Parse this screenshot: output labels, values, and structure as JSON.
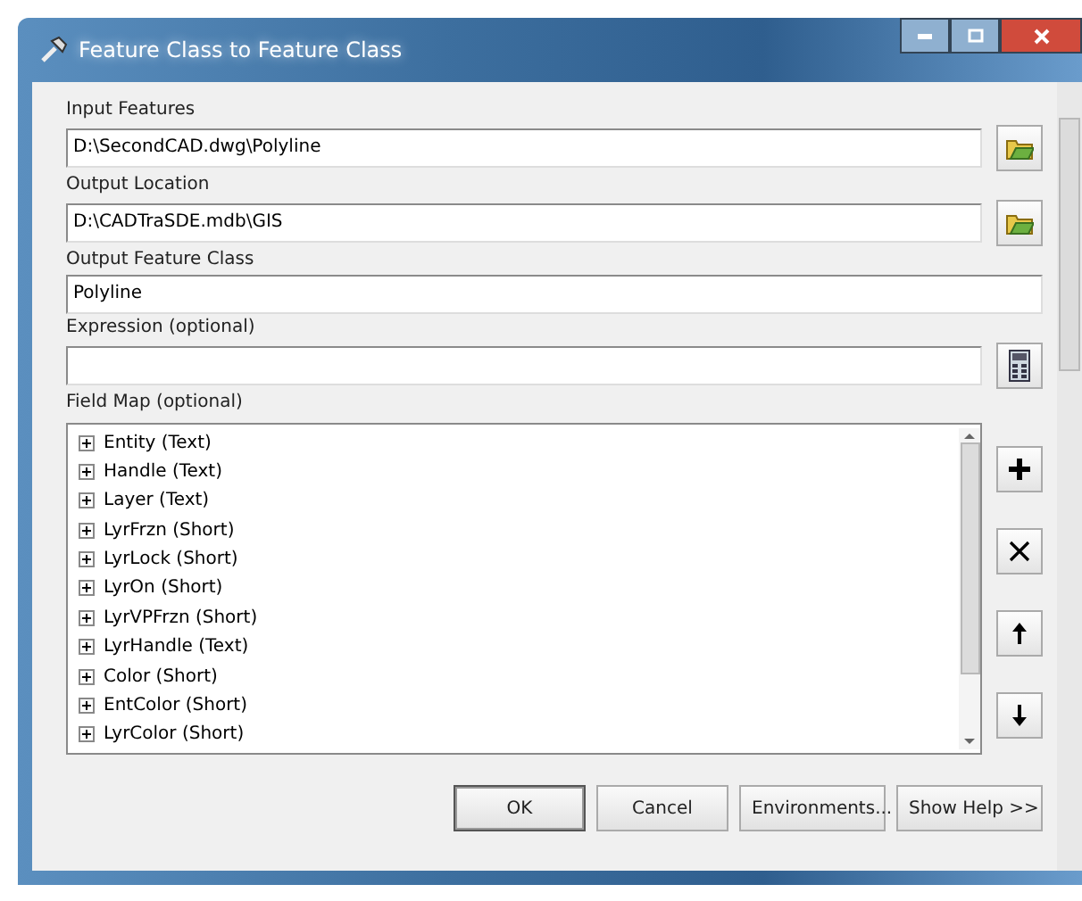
{
  "window": {
    "title": "Feature Class to Feature Class"
  },
  "fields": [
    {
      "kind": "browse",
      "label": "Input Features",
      "value": "D:\\SecondCAD.dwg\\Polyline"
    },
    {
      "kind": "browse",
      "label": "Output Location",
      "value": "D:\\CADTraSDE.mdb\\GIS"
    },
    {
      "kind": "text",
      "label": "Output Feature Class",
      "value": "Polyline"
    },
    {
      "kind": "sql",
      "label": "Expression (optional)"
    }
  ],
  "field_map": {
    "label": "Field Map (optional)",
    "items": [
      {
        "label": "Entity (Text)",
        "expanded": false
      },
      {
        "label": "Handle (Text)",
        "expanded": false
      },
      {
        "label": "Layer (Text)",
        "expanded": false
      },
      {
        "label": "LyrFrzn (Short)",
        "expanded": false
      },
      {
        "label": "LyrLock (Short)",
        "expanded": false
      },
      {
        "label": "LyrOn (Short)",
        "expanded": false
      },
      {
        "label": "LyrVPFrzn (Short)",
        "expanded": false
      },
      {
        "label": "LyrHandle (Text)",
        "expanded": false
      },
      {
        "label": "Color (Short)",
        "expanded": false
      },
      {
        "label": "EntColor (Short)",
        "expanded": false
      },
      {
        "label": "LyrColor (Short)",
        "expanded": false
      }
    ]
  },
  "buttons": [
    {
      "label": "OK",
      "kind": "default"
    },
    {
      "label": "Cancel",
      "kind": "normal"
    },
    {
      "label": "Environments...",
      "kind": "normal"
    },
    {
      "label": "Show Help >>",
      "kind": "normal"
    }
  ]
}
